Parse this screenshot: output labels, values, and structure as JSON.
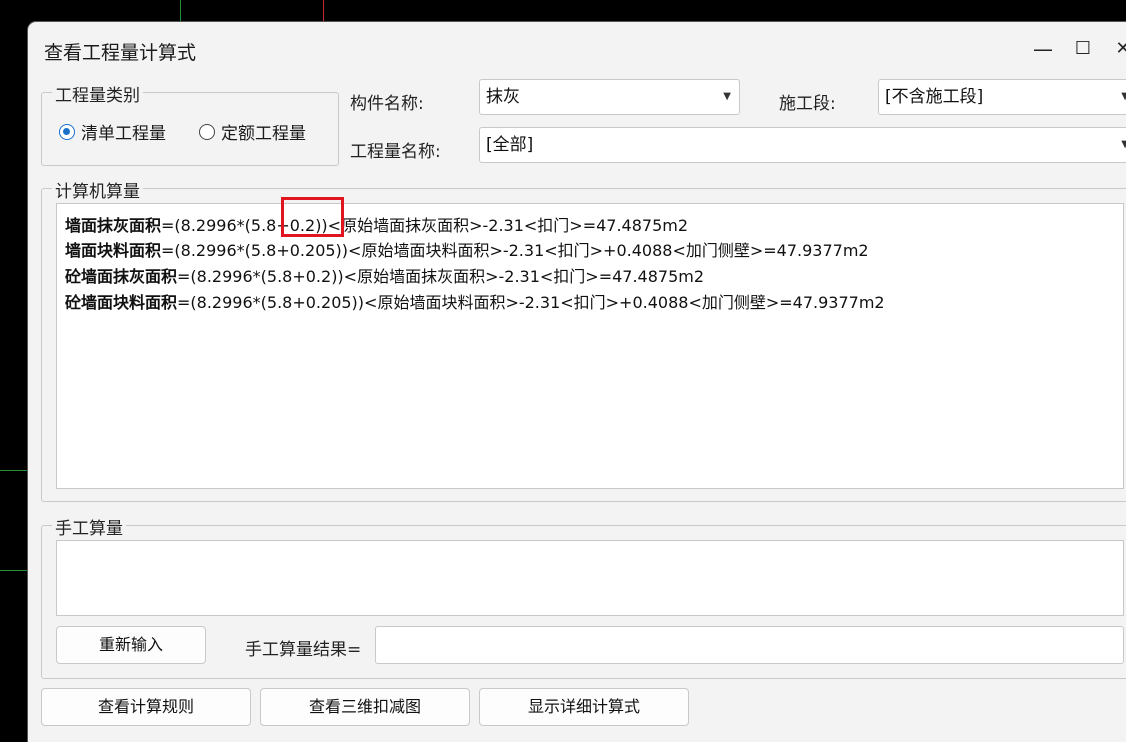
{
  "window": {
    "title": "查看工程量计算式",
    "minimize": "—",
    "maximize": "☐",
    "close": "✕"
  },
  "category": {
    "legend": "工程量类别",
    "options": [
      {
        "label": "清单工程量",
        "selected": true
      },
      {
        "label": "定额工程量",
        "selected": false
      }
    ]
  },
  "fields": {
    "component_label": "构件名称:",
    "component_value": "抹灰",
    "stage_label": "施工段:",
    "stage_value": "[不含施工段]",
    "quantity_label": "工程量名称:",
    "quantity_value": "[全部]"
  },
  "computer_calc": {
    "legend": "计算机算量",
    "lines": [
      {
        "name": "墙面抹灰面积",
        "formula": "=(8.2996*(5.8+0.2))<原始墙面抹灰面积>-2.31<扣门>=47.4875m2"
      },
      {
        "name": "墙面块料面积",
        "formula": "=(8.2996*(5.8+0.205))<原始墙面块料面积>-2.31<扣门>+0.4088<加门侧壁>=47.9377m2"
      },
      {
        "name": "砼墙面抹灰面积",
        "formula": "=(8.2996*(5.8+0.2))<原始墙面抹灰面积>-2.31<扣门>=47.4875m2"
      },
      {
        "name": "砼墙面块料面积",
        "formula": "=(8.2996*(5.8+0.205))<原始墙面块料面积>-2.31<扣门>+0.4088<加门侧壁>=47.9377m2"
      }
    ]
  },
  "manual_calc": {
    "legend": "手工算量",
    "reinput_button": "重新输入",
    "result_label": "手工算量结果=",
    "result_value": ""
  },
  "buttons": {
    "view_rules": "查看计算规则",
    "view_3d": "查看三维扣减图",
    "show_detail": "显示详细计算式"
  },
  "colors": {
    "highlight": "#e0151f",
    "radio_accent": "#1a6fc9"
  }
}
